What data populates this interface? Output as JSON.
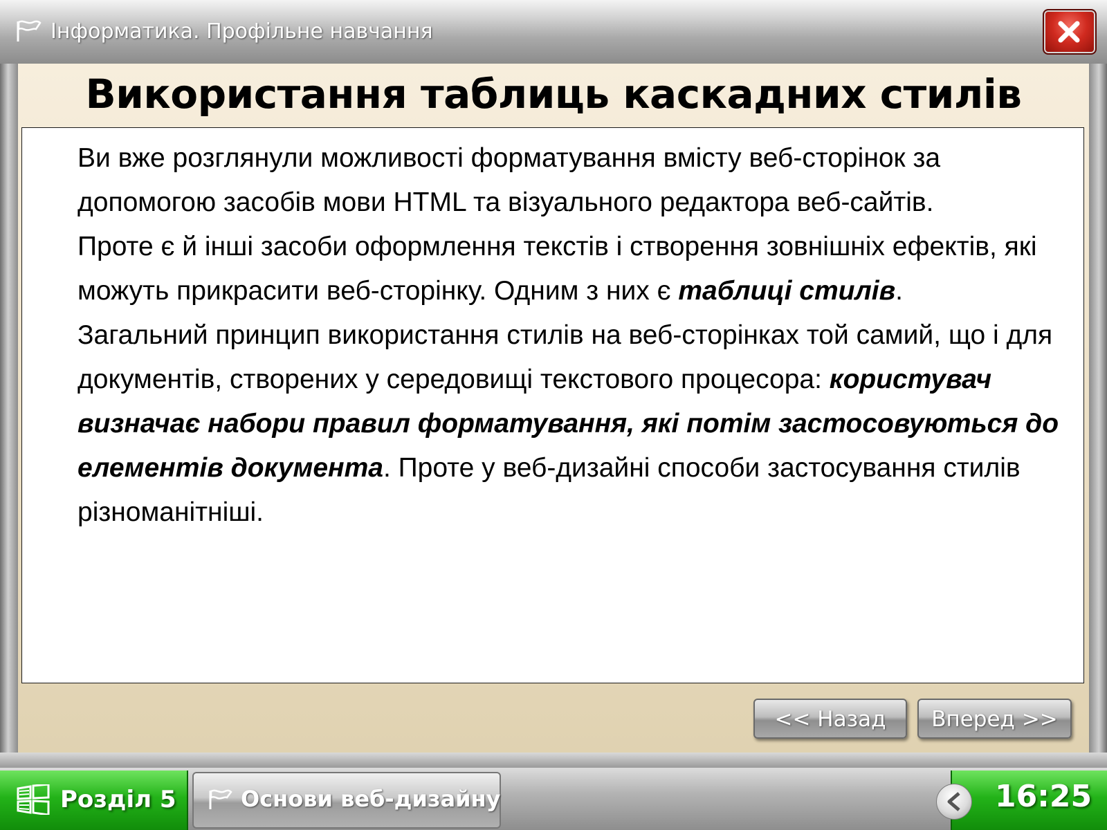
{
  "window": {
    "title": "Інформатика. Профільне навчання",
    "icon": "flag-icon",
    "close_icon": "close-icon"
  },
  "slide": {
    "title": "Використання таблиць каскадних стилів",
    "paragraphs": [
      {
        "text": "Ви вже розглянули можливості форматування вмісту веб-сторінок за допомогою засобів мови HTML та візуального редактора веб-сайтів."
      },
      {
        "text_before": "Проте є й інші засоби оформлення текстів і створення зовнішніх ефектів, які можуть прикрасити веб-сторінку. Одним з них є ",
        "emphasis": "таблиці стилів",
        "text_after": "."
      },
      {
        "text_before": "Загальний принцип використання стилів на веб-сторінках той самий, що і для документів, створених у середовищі текстового процесора: ",
        "emphasis": "користувач визначає набори правил форматування, які потім застосовуються до елементів документа",
        "text_after": ". Проте у веб-дизайні способи застосування стилів різноманітніші."
      }
    ]
  },
  "navigation": {
    "back_label": "<< Назад",
    "next_label": "Вперед >>"
  },
  "taskbar": {
    "start_label": "Розділ 5",
    "start_icon": "windows-icon",
    "task_label": "Основи веб-дизайну",
    "task_icon": "flag-icon",
    "tray_icon": "chevron-left-icon",
    "clock": "16:25"
  },
  "colors": {
    "panel_background": "#efe3cb",
    "taskbar_green": "#23b319",
    "close_red": "#d02a1f"
  }
}
